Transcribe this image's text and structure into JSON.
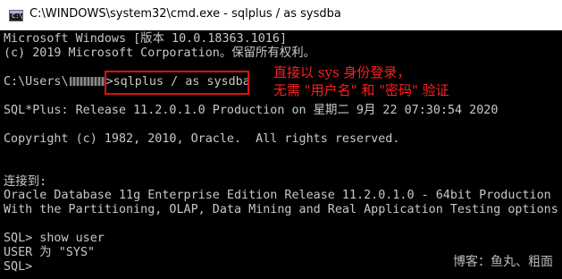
{
  "window": {
    "title": "C:\\WINDOWS\\system32\\cmd.exe - sqlplus  / as sysdba",
    "icon": "cmd-console-icon"
  },
  "console": {
    "lines": [
      "Microsoft Windows [版本 10.0.18363.1016]",
      "(c) 2019 Microsoft Corporation。保留所有权利。",
      "SQL*Plus: Release 11.2.0.1.0 Production on 星期二 9月 22 07:30:54 2020",
      "Copyright (c) 1982, 2010, Oracle.  All rights reserved.",
      "连接到:",
      "Oracle Database 11g Enterprise Edition Release 11.2.0.1.0 - 64bit Production",
      "With the Partitioning, OLAP, Data Mining and Real Application Testing options",
      "SQL> show user",
      "USER 为 \"SYS\"",
      "SQL>"
    ],
    "prompt_prefix": "C:\\Users\\",
    "prompt_suffix": ">",
    "command": "sqlplus / as sysdba"
  },
  "annotation": {
    "line1": "直接以 sys 身份登录，",
    "line2": "无需 \"用户名\" 和 \"密码\" 验证",
    "color": "#ff1f1f"
  },
  "watermark": "博客：鱼丸、粗面"
}
